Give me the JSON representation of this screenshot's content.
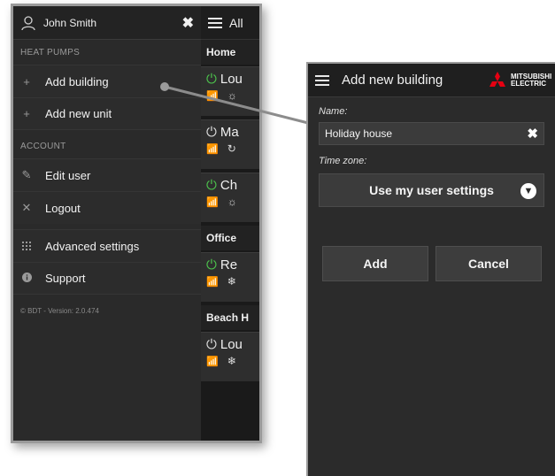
{
  "menu": {
    "username": "John Smith",
    "sections": [
      {
        "label": "HEAT PUMPS",
        "items": [
          {
            "label": "Add building",
            "icon": "plus-icon"
          },
          {
            "label": "Add new unit",
            "icon": "plus-icon"
          }
        ]
      },
      {
        "label": "ACCOUNT",
        "items": [
          {
            "label": "Edit user",
            "icon": "pencil-icon"
          },
          {
            "label": "Logout",
            "icon": "x-icon"
          },
          {
            "label": "Advanced settings",
            "icon": "grid-icon"
          },
          {
            "label": "Support",
            "icon": "info-icon"
          }
        ]
      }
    ],
    "version": "© BDT - Version: 2.0.474"
  },
  "unit_list": {
    "title": "All",
    "groups": [
      {
        "name": "Home",
        "units": [
          {
            "name": "Lou",
            "power": "on",
            "mode_icon": "sun-icon"
          },
          {
            "name": "Ma",
            "power": "off",
            "mode_icon": "auto-icon"
          },
          {
            "name": "Ch",
            "power": "on",
            "mode_icon": "sun-icon"
          }
        ]
      },
      {
        "name": "Office",
        "units": [
          {
            "name": "Re",
            "power": "on",
            "mode_icon": "snowflake-icon"
          }
        ]
      },
      {
        "name": "Beach H",
        "units": [
          {
            "name": "Lou",
            "power": "off",
            "mode_icon": "snowflake-icon"
          }
        ]
      }
    ]
  },
  "dialog": {
    "title": "Add new building",
    "brand_line1": "MITSUBISHI",
    "brand_line2": "ELECTRIC",
    "name_label": "Name:",
    "name_value": "Holiday house",
    "timezone_label": "Time zone:",
    "timezone_value": "Use my user settings",
    "add_label": "Add",
    "cancel_label": "Cancel"
  },
  "colors": {
    "power_on": "#4cc24c",
    "brand_red": "#e60012",
    "panel_dark": "#2b2b2b"
  }
}
